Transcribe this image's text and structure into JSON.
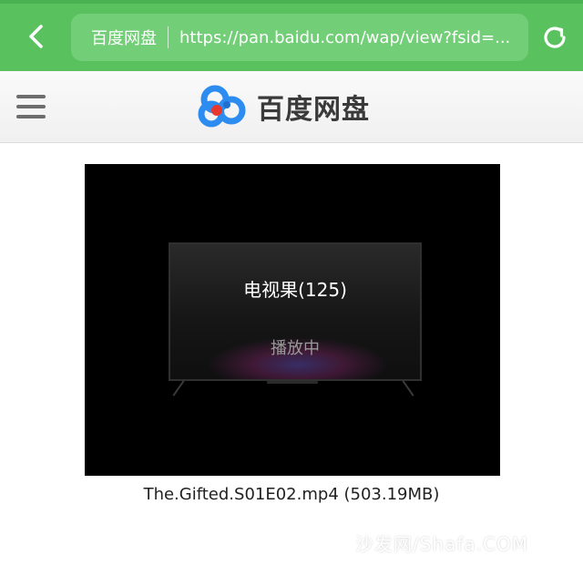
{
  "browser": {
    "site_name": "百度网盘",
    "url": "https://pan.baidu.com/wap/view?fsid=..."
  },
  "header": {
    "brand_text": "百度网盘"
  },
  "player": {
    "tv_title": "电视果(125)",
    "tv_status": "播放中"
  },
  "file": {
    "caption": "The.Gifted.S01E02.mp4 (503.19MB)"
  },
  "watermark": {
    "text": "沙发网/Shafa.COM"
  },
  "colors": {
    "topbar": "#59c25f",
    "urlbox": "#72cf77",
    "player_bg": "#000000"
  },
  "icons": [
    "back-chevron-icon",
    "reload-icon",
    "menu-icon",
    "baidu-cloud-logo-icon",
    "sofa-icon"
  ]
}
